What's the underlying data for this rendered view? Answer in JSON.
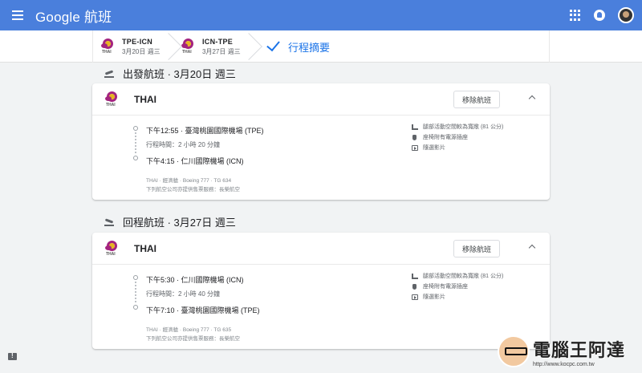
{
  "appbar": {
    "title": "Google 航班"
  },
  "steps": [
    {
      "route": "TPE-ICN",
      "date": "3月20日 週三"
    },
    {
      "route": "ICN-TPE",
      "date": "3月27日 週三"
    }
  ],
  "current_step": "行程摘要",
  "logo_text": "THAI",
  "outbound": {
    "heading": "出發航班 · 3月20日 週三",
    "airline": "THAI",
    "remove_label": "移除航班",
    "depart": "下午12:55 · 臺灣桃園國際機場 (TPE)",
    "duration": "行程時間：2 小時 20 分鐘",
    "arrive": "下午4:15 · 仁川國際機場 (ICN)",
    "meta": "THAI · 經濟艙 · Boeing 777 · TG 634",
    "sold_by": "下列航空公司亦提供售票服務：長榮航空",
    "amenities": [
      "腿部活動空間較為寬敞 (81 公分)",
      "座椅附有電源插座",
      "隨選影片"
    ]
  },
  "return": {
    "heading": "回程航班 · 3月27日 週三",
    "airline": "THAI",
    "remove_label": "移除航班",
    "depart": "下午5:30 · 仁川國際機場 (ICN)",
    "duration": "行程時間：2 小時 40 分鐘",
    "arrive": "下午7:10 · 臺灣桃園國際機場 (TPE)",
    "meta": "THAI · 經濟艙 · Boeing 777 · TG 635",
    "sold_by": "下列航空公司亦提供售票服務：長榮航空",
    "amenities": [
      "腿部活動空間較為寬敞 (81 公分)",
      "座椅附有電源插座",
      "隨選影片"
    ]
  },
  "watermark": {
    "title": "電腦王阿達",
    "url": "http://www.kocpc.com.tw"
  },
  "colors": {
    "appbar": "#4a7fdc",
    "accent": "#1a73e8",
    "background": "#f1f3f4",
    "logo_purple": "#a4247f",
    "logo_gold": "#e6b422"
  },
  "icons": [
    "menu-icon",
    "apps-icon",
    "notifications-icon",
    "takeoff-icon",
    "landing-icon",
    "legroom-icon",
    "power-icon",
    "video-icon",
    "chevron-up-icon",
    "check-icon",
    "feedback-icon"
  ]
}
